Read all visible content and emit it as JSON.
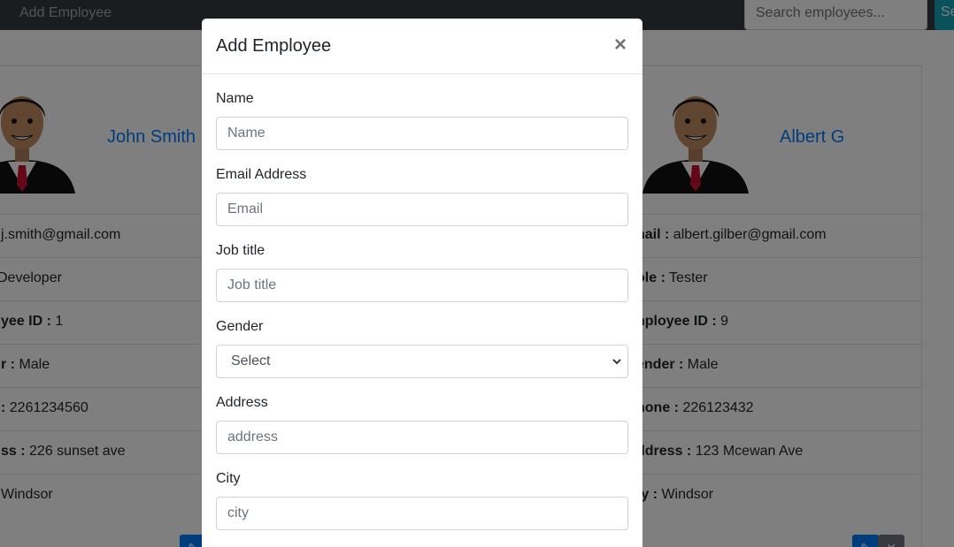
{
  "navbar": {
    "add_employee_link": "Add Employee",
    "search_placeholder": "Search employees...",
    "search_button_label": "Search"
  },
  "cards": [
    {
      "name": "John Smith",
      "rows": [
        {
          "label": "",
          "value": "j.smith@gmail.com"
        },
        {
          "label": "",
          "value": "Developer"
        },
        {
          "label": "yee ID :",
          "value": " 1"
        },
        {
          "label": "r :",
          "value": " Male"
        },
        {
          "label": ":",
          "value": " 2261234560"
        },
        {
          "label": "ss :",
          "value": " 226 sunset ave"
        },
        {
          "label": "",
          "value": "Windsor"
        }
      ]
    },
    {
      "name": "Albert G",
      "rows": [
        {
          "label": "nail :",
          "value": " albert.gilber@gmail.com"
        },
        {
          "label": "ole :",
          "value": " Tester"
        },
        {
          "label": "nployee ID :",
          "value": " 9"
        },
        {
          "label": "ender :",
          "value": " Male"
        },
        {
          "label": "hone :",
          "value": " 226123432"
        },
        {
          "label": "ddress :",
          "value": " 123 Mcewan Ave"
        },
        {
          "label": "ty :",
          "value": " Windsor"
        }
      ]
    }
  ],
  "modal": {
    "title": "Add Employee",
    "close_symbol": "×",
    "fields": {
      "name": {
        "label": "Name",
        "placeholder": "Name"
      },
      "email": {
        "label": "Email Address",
        "placeholder": "Email"
      },
      "job_title": {
        "label": "Job title",
        "placeholder": "Job title"
      },
      "gender": {
        "label": "Gender",
        "selected": "Select"
      },
      "address": {
        "label": "Address",
        "placeholder": "address"
      },
      "city": {
        "label": "City",
        "placeholder": "city"
      }
    }
  },
  "colors": {
    "navbar_bg": "#343a40",
    "link_blue": "#007bff",
    "search_button": "#17a2b8",
    "edit_button": "#007bff",
    "delete_button": "#6c757d"
  },
  "icons": [
    "pencil-icon",
    "close-icon",
    "chevron-down-icon",
    "avatar"
  ]
}
